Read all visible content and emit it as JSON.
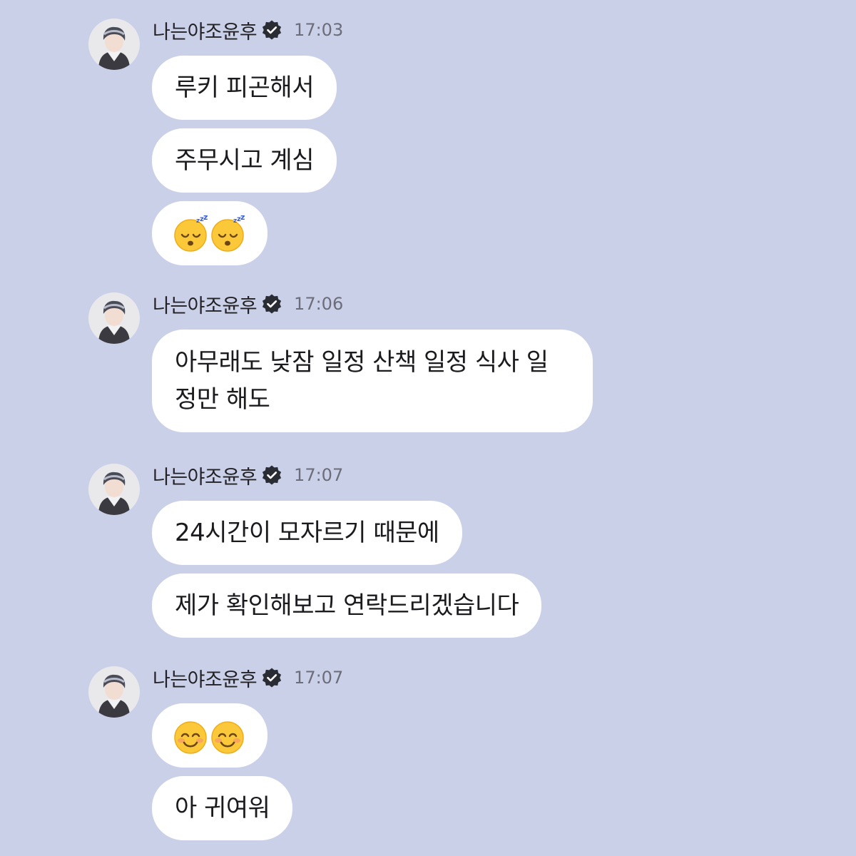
{
  "sender": {
    "name": "나는야조윤후",
    "verified_icon": "verified-badge-icon",
    "avatar_icon": "profile-photo-avatar"
  },
  "groups": [
    {
      "time": "17:03",
      "messages": [
        {
          "type": "text",
          "text": "루키 피곤해서"
        },
        {
          "type": "text",
          "text": "주무시고 계심"
        },
        {
          "type": "emoji",
          "emojis": [
            "😴",
            "😴"
          ],
          "emoji_icon": "sleeping-face-icon"
        }
      ]
    },
    {
      "time": "17:06",
      "messages": [
        {
          "type": "text",
          "text": "아무래도 낮잠 일정 산책 일정 식사 일\n정만 해도"
        }
      ]
    },
    {
      "time": "17:07",
      "messages": [
        {
          "type": "text",
          "text": "24시간이 모자르기 때문에"
        },
        {
          "type": "text",
          "text": "제가 확인해보고 연락드리겠습니다"
        }
      ]
    },
    {
      "time": "17:07",
      "messages": [
        {
          "type": "emoji",
          "emojis": [
            "😊",
            "😊"
          ],
          "emoji_icon": "smiling-face-icon"
        },
        {
          "type": "text",
          "text": "아 귀여워"
        }
      ]
    }
  ]
}
